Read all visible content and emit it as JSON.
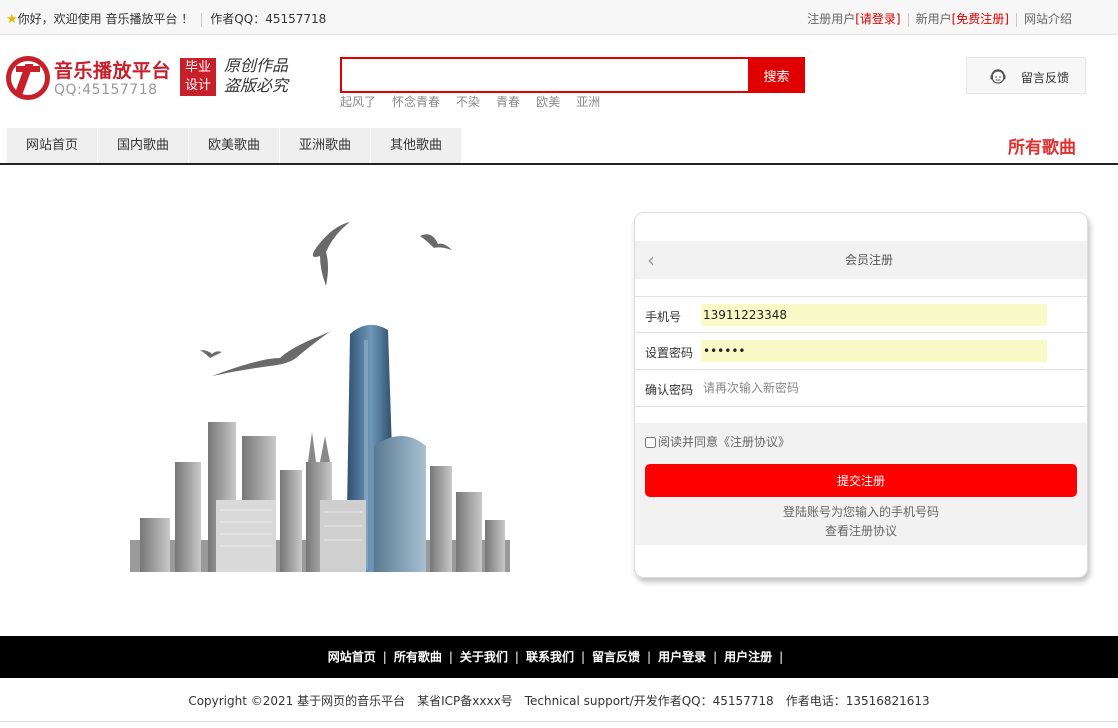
{
  "topbar": {
    "welcome": "你好，欢迎使用 音乐播放平台 ！",
    "author": "作者QQ：45157718",
    "register_user": "注册用户",
    "login_link": "[请登录]",
    "new_user": "新用户",
    "free_register_link": "[免费注册]",
    "site_intro": "网站介绍"
  },
  "logo": {
    "title": "音乐播放平台",
    "qq": "QQ:45157718",
    "badge_line1": "毕业",
    "badge_line2": "设计",
    "slogan_line1": "原创作品",
    "slogan_line2": "盗版必究"
  },
  "search": {
    "value": "",
    "button": "搜索",
    "hot_words": [
      "起风了",
      "怀念青春",
      "不染",
      "青春",
      "欧美",
      "亚洲"
    ]
  },
  "feedback": {
    "label": "留言反馈"
  },
  "nav": {
    "items": [
      "网站首页",
      "国内歌曲",
      "欧美歌曲",
      "亚洲歌曲",
      "其他歌曲"
    ],
    "all_songs": "所有歌曲"
  },
  "register": {
    "title": "会员注册",
    "phone_label": "手机号",
    "phone_value": "13911223348",
    "password_label": "设置密码",
    "password_value": "••••••",
    "confirm_label": "确认密码",
    "confirm_placeholder": "请再次输入新密码",
    "agree_text": "阅读并同意《注册协议》",
    "submit": "提交注册",
    "tip": "登陆账号为您输入的手机号码",
    "view_agreement": "查看注册协议"
  },
  "footer": {
    "links": [
      "网站首页",
      "所有歌曲",
      "关于我们",
      "联系我们",
      "留言反馈",
      "用户登录",
      "用户注册"
    ],
    "copyright": "Copyright ©2021 基于网页的音乐平台",
    "icp": "某省ICP备xxxx号",
    "support": "Technical support/开发作者QQ：45157718",
    "phone": "作者电话：13516821613"
  }
}
